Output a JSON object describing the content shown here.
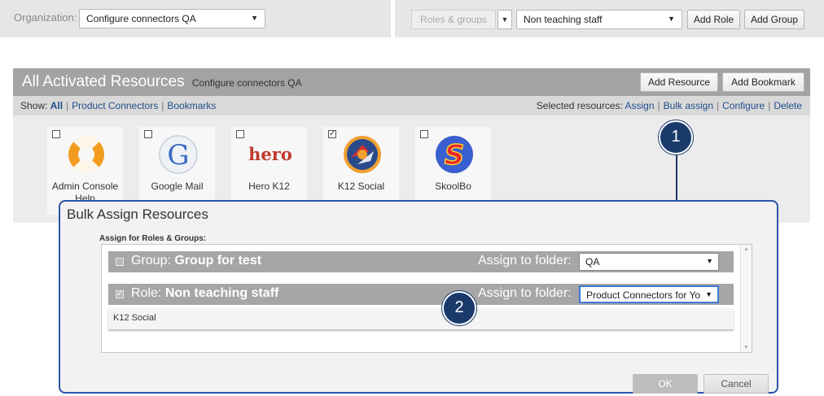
{
  "topbar": {
    "org_label": "Organization:",
    "org_value": "Configure connectors QA",
    "roles_groups_label": "Roles & groups",
    "role_value": "Non teaching staff",
    "add_role": "Add Role",
    "add_group": "Add Group"
  },
  "panel": {
    "title": "All Activated Resources",
    "subtitle": "Configure connectors QA",
    "add_resource": "Add Resource",
    "add_bookmark": "Add Bookmark",
    "show_label": "Show:",
    "filters": [
      "All",
      "Product Connectors",
      "Bookmarks"
    ],
    "selected_label": "Selected resources:",
    "actions": [
      "Assign",
      "Bulk assign",
      "Configure",
      "Delete"
    ]
  },
  "tiles": [
    {
      "label": "Admin Console Help",
      "checked": false,
      "icon": "lifebuoy-icon"
    },
    {
      "label": "Google Mail",
      "checked": false,
      "icon": "google-g-icon"
    },
    {
      "label": "Hero K12",
      "checked": false,
      "icon": "hero-logo",
      "logo_text": "hero"
    },
    {
      "label": "K12 Social",
      "checked": true,
      "icon": "k12-social-icon"
    },
    {
      "label": "SkoolBo",
      "checked": false,
      "icon": "skoolbo-icon"
    }
  ],
  "callouts": [
    "1",
    "2"
  ],
  "modal": {
    "title": "Bulk Assign Resources",
    "assign_label": "Assign for Roles & Groups:",
    "rows": [
      {
        "kind": "Group:",
        "name": "Group for test",
        "folder_label": "Assign to folder:",
        "folder": "QA",
        "checked": false
      },
      {
        "kind": "Role:",
        "name": "Non teaching staff",
        "folder_label": "Assign to folder:",
        "folder": "Product Connectors for Yo",
        "checked": true
      }
    ],
    "expanded_item": "K12 Social",
    "ok": "OK",
    "cancel": "Cancel"
  },
  "colors": {
    "accent": "#1a3a6b",
    "modal_border": "#2a54a8",
    "link": "#1f4d8a",
    "header_bg": "#a3a3a3"
  }
}
